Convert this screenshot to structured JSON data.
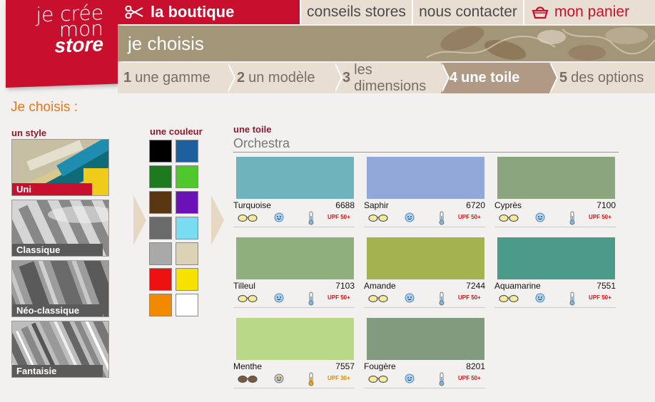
{
  "logo": {
    "line1": "je crée",
    "line2": "mon",
    "line3": "store"
  },
  "topnav": {
    "boutique": "la boutique",
    "conseils": "conseils stores",
    "contact": "nous contacter",
    "panier": "mon panier"
  },
  "banner": {
    "title": "je choisis"
  },
  "steps": [
    {
      "num": "1",
      "label": "une gamme"
    },
    {
      "num": "2",
      "label": "un modèle"
    },
    {
      "num": "3",
      "label": "les dimensions"
    },
    {
      "num": "4",
      "label": "une toile"
    },
    {
      "num": "5",
      "label": "des options"
    }
  ],
  "heading": "Je choisis :",
  "styles": {
    "label": "un style",
    "items": [
      {
        "name": "Uni",
        "selected": true
      },
      {
        "name": "Classique"
      },
      {
        "name": "Néo-classique"
      },
      {
        "name": "Fantaisie"
      }
    ]
  },
  "colors": {
    "label": "une couleur",
    "swatches": [
      "#000000",
      "#1e5f9e",
      "#1e7a1e",
      "#4ec82a",
      "#5a3511",
      "#6a12b8",
      "#6b6b6b",
      "#7adcf2",
      "#a9a9a9",
      "#dcd2b6",
      "#ee1111",
      "#f7e100",
      "#f28a00",
      "#ffffff"
    ]
  },
  "toile": {
    "title": "une toile",
    "subtitle": "Orchestra",
    "upf50": "UPF 50+",
    "upf30": "UPF 30+",
    "items": [
      {
        "name": "Turquoise",
        "code": "6688",
        "color": "#6fb3bd"
      },
      {
        "name": "Saphir",
        "code": "6720",
        "color": "#91a8d8"
      },
      {
        "name": "Cyprès",
        "code": "7100",
        "color": "#8ba57f"
      },
      {
        "name": "Tilleul",
        "code": "7103",
        "color": "#8fb07c"
      },
      {
        "name": "Amande",
        "code": "7244",
        "color": "#a4b350"
      },
      {
        "name": "Aquamarine",
        "code": "7551",
        "color": "#4c9a8a"
      },
      {
        "name": "Menthe",
        "code": "7557",
        "color": "#b9d888"
      },
      {
        "name": "Fougère",
        "code": "8201",
        "color": "#829a7d"
      }
    ]
  }
}
